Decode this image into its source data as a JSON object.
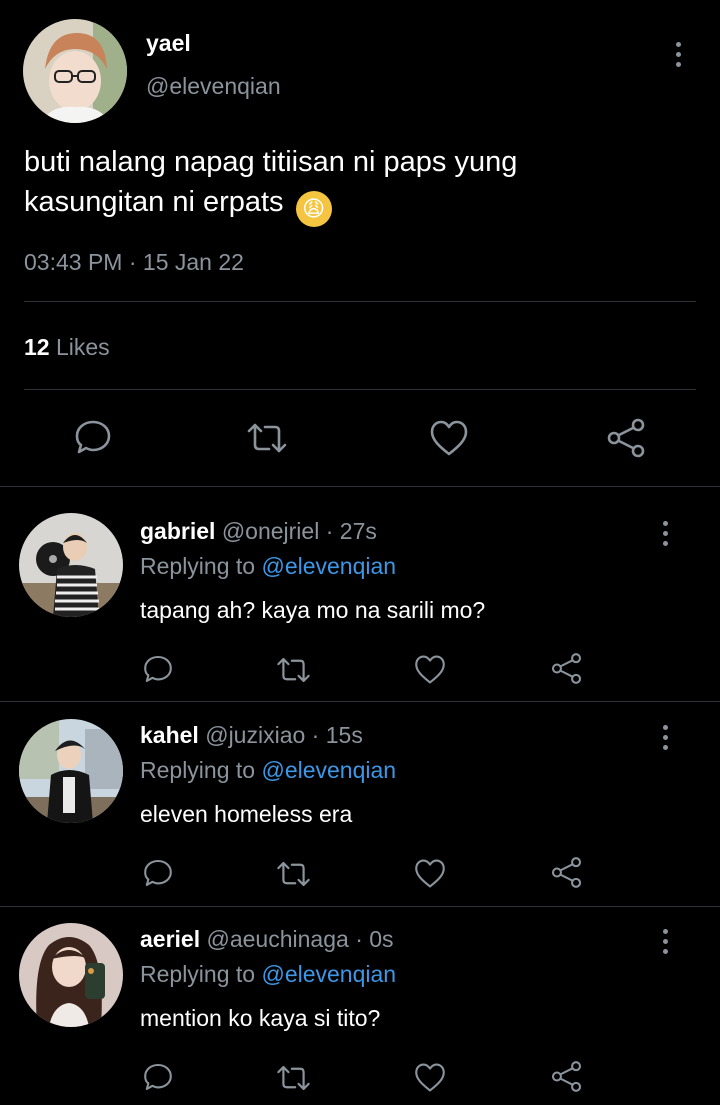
{
  "main_tweet": {
    "display_name": "yael",
    "handle": "@elevenqian",
    "text_line1": "buti nalang napag titiisan ni paps yung",
    "text_line2": "kasungitan ni erpats",
    "emoji": "😩",
    "time": "03:43 PM",
    "separator": "·",
    "date": "15 Jan 22",
    "likes_count": "12",
    "likes_label": "Likes"
  },
  "replies": [
    {
      "name": "gabriel",
      "handle": "@onejriel",
      "sep": "·",
      "time": "27s",
      "replying_prefix": "Replying to",
      "replying_to": "@elevenqian",
      "text": "tapang ah? kaya mo na sarili mo?"
    },
    {
      "name": "kahel",
      "handle": "@juzixiao",
      "sep": "·",
      "time": "15s",
      "replying_prefix": "Replying to",
      "replying_to": "@elevenqian",
      "text": "eleven homeless era"
    },
    {
      "name": "aeriel",
      "handle": "@aeuchinaga",
      "sep": "·",
      "time": "0s",
      "replying_prefix": "Replying to",
      "replying_to": "@elevenqian",
      "text": "mention ko kaya si tito?"
    }
  ],
  "icons": {
    "more": "kebab-icon",
    "reply": "reply-icon",
    "retweet": "retweet-icon",
    "like": "heart-icon",
    "share": "share-icon"
  },
  "colors": {
    "background": "#000000",
    "muted": "#8b949c",
    "link": "#3d97e6",
    "divider": "#2f3336"
  }
}
